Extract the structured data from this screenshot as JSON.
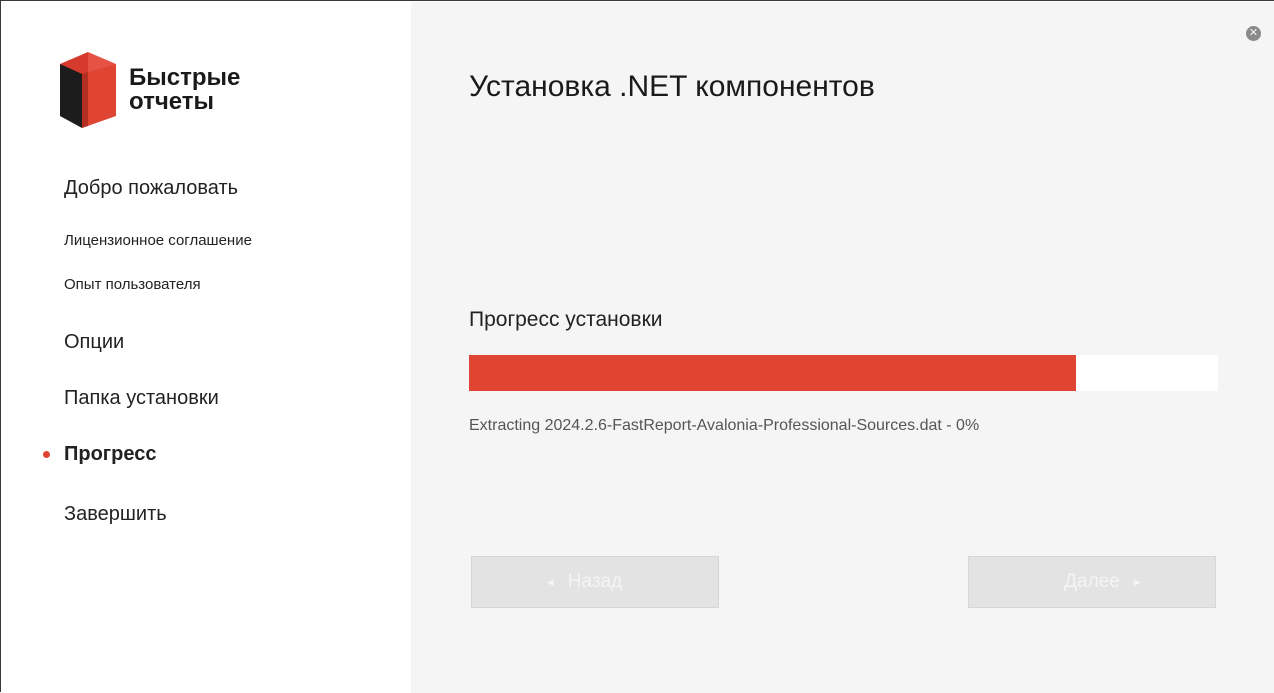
{
  "brand": {
    "line1": "Быстрые",
    "line2": "отчеты",
    "accent_color": "#e04433",
    "logo_icon": "cube-logo-icon"
  },
  "sidebar": {
    "items": [
      {
        "label": "Добро пожаловать",
        "active": false
      },
      {
        "label": "Лицензионное соглашение",
        "active": false
      },
      {
        "label": "Опыт пользователя",
        "active": false
      },
      {
        "label": "Опции",
        "active": false
      },
      {
        "label": "Папка установки",
        "active": false
      },
      {
        "label": "Прогресс",
        "active": true
      },
      {
        "label": "Завершить",
        "active": false
      }
    ]
  },
  "main": {
    "title": "Установка .NET компонентов",
    "progress_label": "Прогресс установки",
    "progress_fraction": 0.81,
    "status_text": "Extracting 2024.2.6-FastReport-Avalonia-Professional-Sources.dat - 0%"
  },
  "buttons": {
    "back_label": "Назад",
    "next_label": "Далее",
    "back_icon": "arrow-left-icon",
    "next_icon": "arrow-right-icon"
  },
  "window": {
    "close_icon": "close-icon"
  }
}
